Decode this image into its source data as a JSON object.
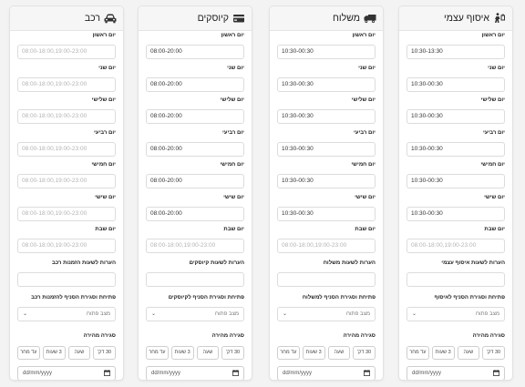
{
  "cards": [
    {
      "title": "איסוף עצמי",
      "icon": "person-walking-icon",
      "days": [
        {
          "label": "יום ראשון",
          "value": "10:30-13:30"
        },
        {
          "label": "יום שני",
          "value": "10:30-00:30"
        },
        {
          "label": "יום שלישי",
          "value": "10:30-00:30"
        },
        {
          "label": "יום רביעי",
          "value": "10:30-00:30"
        },
        {
          "label": "יום חמישי",
          "value": "10:30-00:30"
        },
        {
          "label": "יום שישי",
          "value": "10:30-00:30"
        },
        {
          "label": "יום שבת",
          "placeholder": "08:00-18:00,19:00-23:00"
        }
      ],
      "notes_label": "הערות לשעות איסוף עצמי",
      "select_label": "פתיחת וסגירת הסניף לאיסוף",
      "select_value": "מצב פתוח",
      "closure_label": "סגירה מהירה",
      "pills": [
        "30 דק'",
        "שעה",
        "3 שעות",
        "עד מחר"
      ],
      "date_placeholder": "dd/mm/yyyy"
    },
    {
      "title": "משלוח",
      "icon": "truck-icon",
      "days": [
        {
          "label": "יום ראשון",
          "value": "10:30-00:30"
        },
        {
          "label": "יום שני",
          "value": "10:30-00:30"
        },
        {
          "label": "יום שלישי",
          "value": "10:30-00:30"
        },
        {
          "label": "יום רביעי",
          "value": "10:30-00:30"
        },
        {
          "label": "יום חמישי",
          "value": "10:30-00:30"
        },
        {
          "label": "יום שישי",
          "value": "10:30-00:30"
        },
        {
          "label": "יום שבת",
          "placeholder": "08:00-18:00,19:00-23:00"
        }
      ],
      "notes_label": "הערות לשעות משלוח",
      "select_label": "פתיחת וסגירת הסניף למשלוח",
      "select_value": "מצב פתוח",
      "closure_label": "סגירה מהירה",
      "pills": [
        "30 דק'",
        "שעה",
        "3 שעות",
        "עד מחר"
      ],
      "date_placeholder": "dd/mm/yyyy"
    },
    {
      "title": "קיוסקים",
      "icon": "kiosk-icon",
      "days": [
        {
          "label": "יום ראשון",
          "value": "08:00-20:00"
        },
        {
          "label": "יום שני",
          "value": "08:00-20:00"
        },
        {
          "label": "יום שלישי",
          "value": "08:00-20:00"
        },
        {
          "label": "יום רביעי",
          "value": "08:00-20:00"
        },
        {
          "label": "יום חמישי",
          "value": "08:00-20:00"
        },
        {
          "label": "יום שישי",
          "value": "08:00-20:00"
        },
        {
          "label": "יום שבת",
          "placeholder": "08:00-18:00,19:00-23:00"
        }
      ],
      "notes_label": "הערות לשעות קיוסקים",
      "select_label": "פתיחת וסגירת הסניף לקיוסקים",
      "select_value": "מצב פתוח",
      "closure_label": "סגירה מהירה",
      "pills": [
        "30 דק'",
        "שעה",
        "3 שעות",
        "עד מחר"
      ],
      "date_placeholder": "dd/mm/yyyy"
    },
    {
      "title": "רכב",
      "icon": "car-icon",
      "days": [
        {
          "label": "יום ראשון",
          "placeholder": "08:00-18:00,19:00-23:00"
        },
        {
          "label": "יום שני",
          "placeholder": "08:00-18:00,19:00-23:00"
        },
        {
          "label": "יום שלישי",
          "placeholder": "08:00-18:00,19:00-23:00"
        },
        {
          "label": "יום רביעי",
          "placeholder": "08:00-18:00,19:00-23:00"
        },
        {
          "label": "יום חמישי",
          "placeholder": "08:00-18:00,19:00-23:00"
        },
        {
          "label": "יום שישי",
          "placeholder": "08:00-18:00,19:00-23:00"
        },
        {
          "label": "יום שבת",
          "placeholder": "08:00-18:00,19:00-23:00"
        }
      ],
      "notes_label": "הערות לשעות הזמנות רכב",
      "select_label": "פתיחת וסגירת הסניף להזמנות רכב",
      "select_value": "מצב פתוח",
      "closure_label": "סגירה מהירה",
      "pills": [
        "30 דק'",
        "שעה",
        "3 שעות",
        "עד מחר"
      ],
      "date_placeholder": "dd/mm/yyyy"
    }
  ]
}
